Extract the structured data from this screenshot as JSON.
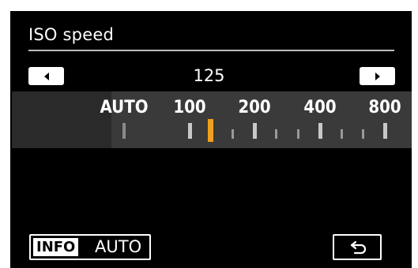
{
  "header": {
    "title": "ISO speed"
  },
  "selector": {
    "current_value": "125",
    "prev_icon": "left-triangle-icon",
    "next_icon": "right-triangle-icon"
  },
  "scale": {
    "labels": [
      "AUTO",
      "100",
      "200",
      "400",
      "800"
    ]
  },
  "footer": {
    "info_label": "INFO",
    "info_value": "AUTO",
    "back_icon": "return-arrow-icon"
  },
  "colors": {
    "selected_marker": "#f0a020"
  }
}
